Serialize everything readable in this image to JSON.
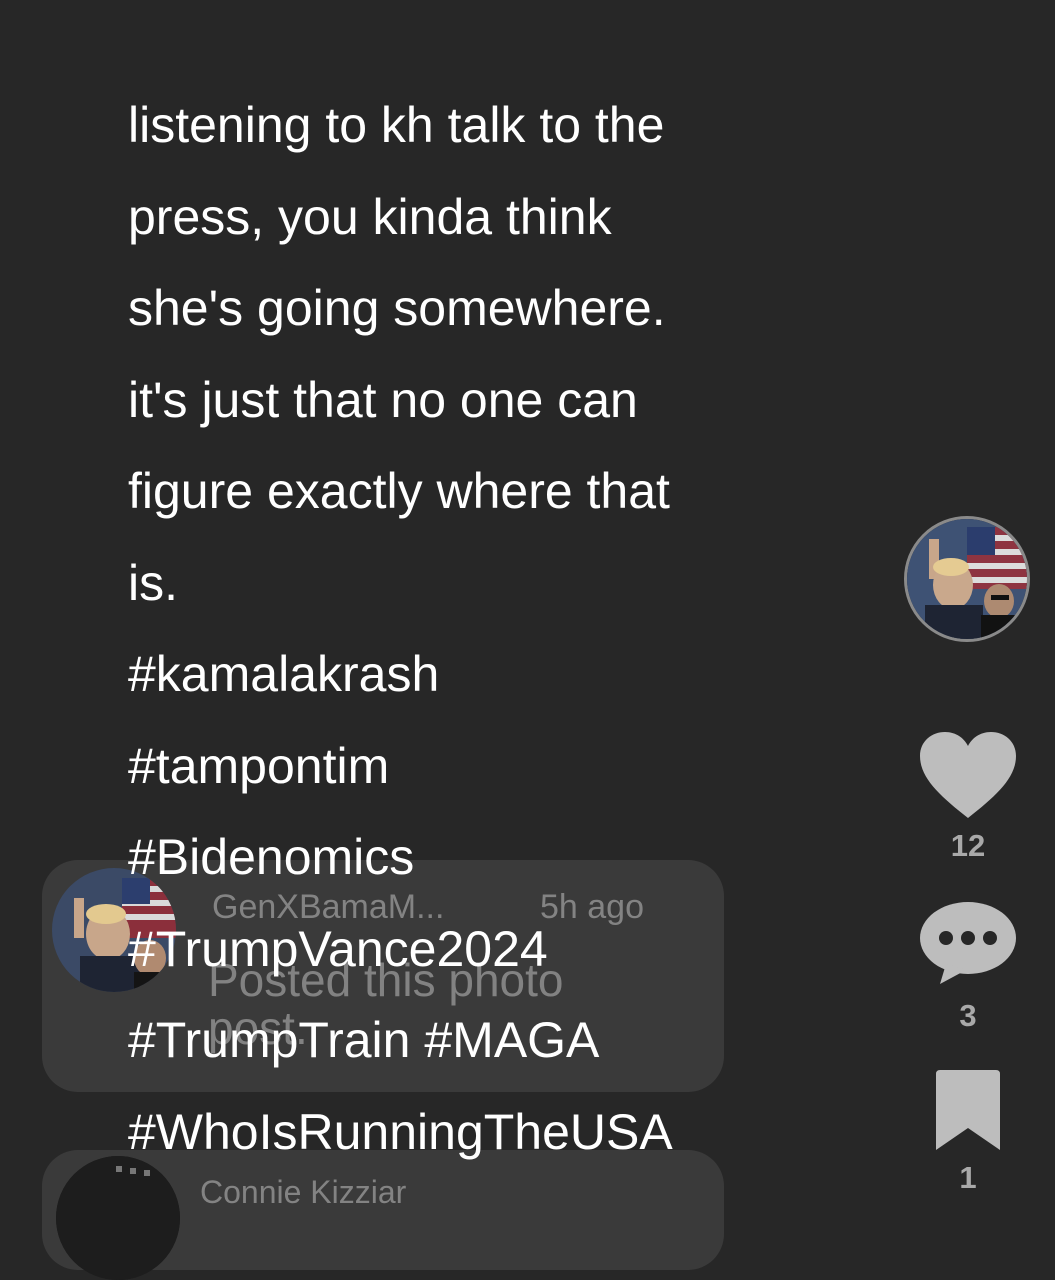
{
  "post": {
    "lines": [
      "listening to kh talk to the",
      "press, you kinda think",
      "she's going somewhere.",
      "it's just that no one can",
      "figure exactly where that",
      "is.",
      "#kamalakrash",
      "#tampontim",
      "#Bidenomics",
      "#TrumpVance2024",
      "#TrumpTrain #MAGA",
      "#WhoIsRunningTheUSA"
    ]
  },
  "actions": {
    "likes": "12",
    "comments": "3",
    "saves": "1"
  },
  "comments": [
    {
      "username": "GenXBamaM...",
      "time": "5h ago",
      "text": "Posted this photo post."
    },
    {
      "username": "Connie Kizziar"
    }
  ],
  "icons": {
    "like": "heart-icon",
    "comment": "speech-bubble-icon",
    "save": "bookmark-icon"
  },
  "colors": {
    "background": "#272727",
    "icon": "#bdbdbd",
    "text": "#ffffff",
    "count": "#a9a9a9"
  }
}
